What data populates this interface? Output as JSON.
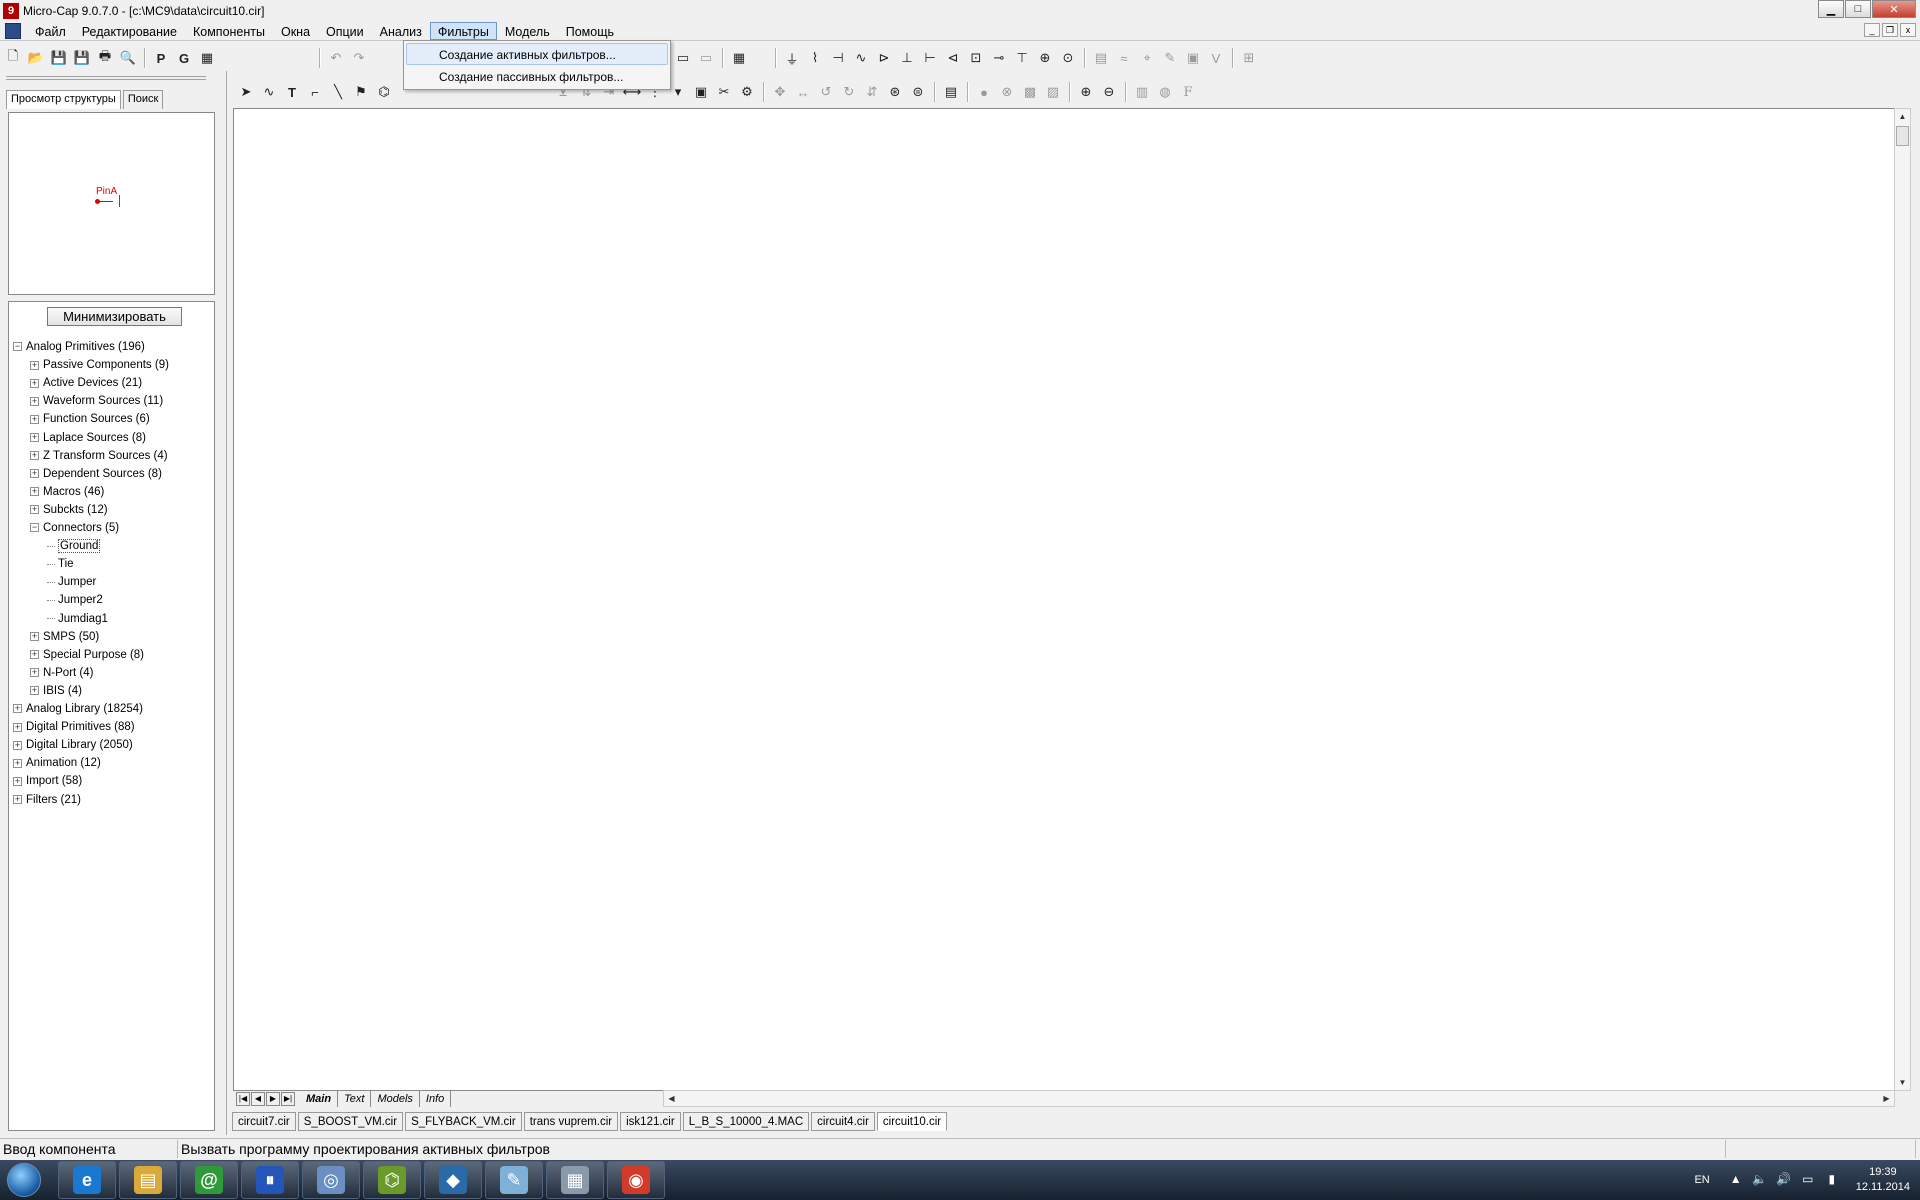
{
  "window": {
    "title": "Micro-Cap 9.0.7.0 - [c:\\MC9\\data\\circuit10.cir]",
    "app_icon_glyph": "9",
    "controls": [
      "minimize-icon",
      "maximize-icon",
      "close-icon"
    ]
  },
  "menu": {
    "items": [
      "Файл",
      "Редактирование",
      "Компоненты",
      "Окна",
      "Опции",
      "Анализ",
      "Фильтры",
      "Модель",
      "Помощь"
    ],
    "active_index": 6
  },
  "dropdown": {
    "items": [
      "Создание активных фильтров...",
      "Создание пассивных фильтров..."
    ],
    "hover_index": 0
  },
  "toolbar": {
    "letter_buttons": [
      "P",
      "G"
    ],
    "last_tool_glyph": "F"
  },
  "left_panel": {
    "tabs": [
      "Просмотр структуры",
      "Поиск"
    ],
    "active_tab_index": 0,
    "preview_label": "PinA",
    "minimize_label": "Минимизировать",
    "tree": [
      {
        "label": "Analog Primitives (196)",
        "level": 0,
        "state": "expanded"
      },
      {
        "label": "Passive Components (9)",
        "level": 1,
        "state": "collapsed"
      },
      {
        "label": "Active Devices (21)",
        "level": 1,
        "state": "collapsed"
      },
      {
        "label": "Waveform Sources (11)",
        "level": 1,
        "state": "collapsed"
      },
      {
        "label": "Function Sources (6)",
        "level": 1,
        "state": "collapsed"
      },
      {
        "label": "Laplace Sources (8)",
        "level": 1,
        "state": "collapsed"
      },
      {
        "label": "Z Transform Sources (4)",
        "level": 1,
        "state": "collapsed"
      },
      {
        "label": "Dependent Sources (8)",
        "level": 1,
        "state": "collapsed"
      },
      {
        "label": "Macros (46)",
        "level": 1,
        "state": "collapsed"
      },
      {
        "label": "Subckts (12)",
        "level": 1,
        "state": "collapsed"
      },
      {
        "label": "Connectors (5)",
        "level": 1,
        "state": "expanded"
      },
      {
        "label": "Ground",
        "level": 2,
        "state": "leaf",
        "selected": true
      },
      {
        "label": "Tie",
        "level": 2,
        "state": "leaf"
      },
      {
        "label": "Jumper",
        "level": 2,
        "state": "leaf"
      },
      {
        "label": "Jumper2",
        "level": 2,
        "state": "leaf"
      },
      {
        "label": "Jumdiag1",
        "level": 2,
        "state": "leaf"
      },
      {
        "label": "SMPS (50)",
        "level": 1,
        "state": "collapsed"
      },
      {
        "label": "Special Purpose (8)",
        "level": 1,
        "state": "collapsed"
      },
      {
        "label": "N-Port (4)",
        "level": 1,
        "state": "collapsed"
      },
      {
        "label": "IBIS (4)",
        "level": 1,
        "state": "collapsed"
      },
      {
        "label": "Analog Library (18254)",
        "level": 0,
        "state": "collapsed"
      },
      {
        "label": "Digital Primitives (88)",
        "level": 0,
        "state": "collapsed"
      },
      {
        "label": "Digital Library (2050)",
        "level": 0,
        "state": "collapsed"
      },
      {
        "label": "Animation (12)",
        "level": 0,
        "state": "collapsed"
      },
      {
        "label": "Import (58)",
        "level": 0,
        "state": "collapsed"
      },
      {
        "label": "Filters (21)",
        "level": 0,
        "state": "collapsed"
      }
    ]
  },
  "sheet_tabs": [
    "Main",
    "Text",
    "Models",
    "Info"
  ],
  "sheet_active_index": 0,
  "file_tabs": [
    "circuit7.cir",
    "S_BOOST_VM.cir",
    "S_FLYBACK_VM.cir",
    "trans vuprem.cir",
    "isk121.cir",
    "L_B_S_10000_4.MAC",
    "circuit4.cir",
    "circuit10.cir"
  ],
  "file_active_index": 7,
  "status": {
    "left": "Ввод компонента",
    "message": "Вызвать программу проектирования активных фильтров"
  },
  "taskbar": {
    "apps": [
      {
        "icon": "internet-explorer-icon",
        "glyph": "e",
        "color": "#1b78d0"
      },
      {
        "icon": "file-explorer-icon",
        "glyph": "▤",
        "color": "#d9a93a"
      },
      {
        "icon": "mail-agent-icon",
        "glyph": "@",
        "color": "#2f9a3a"
      },
      {
        "icon": "mediaget-icon",
        "glyph": "⏸",
        "color": "#2356b8"
      },
      {
        "icon": "satellite-app-icon",
        "glyph": "◎",
        "color": "#6a8fc0"
      },
      {
        "icon": "microcap-icon",
        "glyph": "⌬",
        "color": "#6a9a2a"
      },
      {
        "icon": "diamond-app-icon",
        "glyph": "◆",
        "color": "#2a6aa8"
      },
      {
        "icon": "notepad-icon",
        "glyph": "✎",
        "color": "#7fb0d8"
      },
      {
        "icon": "calculator-icon",
        "glyph": "▦",
        "color": "#8a9aaa"
      },
      {
        "icon": "chrome-icon",
        "glyph": "◉",
        "color": "#d23a2a"
      }
    ],
    "lang": "EN",
    "time": "19:39",
    "date": "12.11.2014"
  }
}
